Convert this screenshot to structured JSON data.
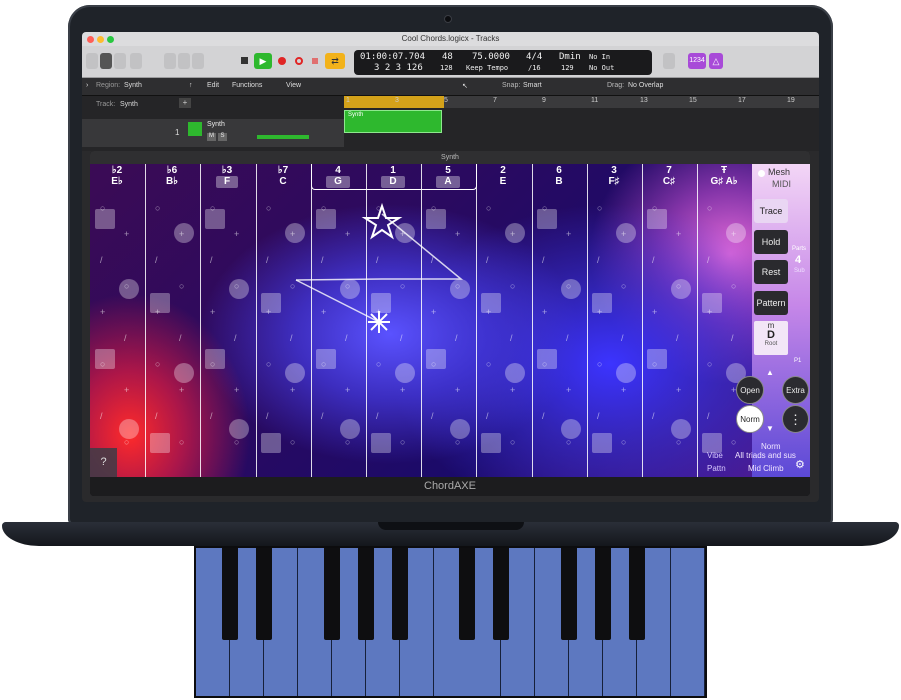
{
  "window": {
    "title": "Cool Chords.logicx - Tracks"
  },
  "lcd": {
    "time": "01:00:07.704",
    "bars": "3  2  3  126",
    "bar_top": "48",
    "bar_bottom": "128",
    "tempo": "75.0000",
    "tempo_mode": "Keep Tempo",
    "sig_top": "4/4",
    "sig_bottom": "/16",
    "key_top": "Dmin",
    "key_bottom": "129",
    "in_top": "No In",
    "in_bottom": "No Out"
  },
  "toolbar": {
    "count_in": "1234"
  },
  "region": {
    "label": "Region:",
    "value": "Synth",
    "track_label": "Track:",
    "track_value": "Synth",
    "menus": [
      "Edit",
      "Functions",
      "View"
    ],
    "snap_label": "Snap:",
    "snap_value": "Smart",
    "drag_label": "Drag:",
    "drag_value": "No Overlap"
  },
  "ruler": [
    "1",
    "3",
    "5",
    "7",
    "9",
    "11",
    "13",
    "15",
    "17",
    "19"
  ],
  "track": {
    "number": "1",
    "name": "Synth",
    "m": "M",
    "s": "S",
    "region_name": "Synth"
  },
  "plugin": {
    "window_title": "Synth",
    "footer": "ChordAXE",
    "columns": [
      {
        "degree": "♭2",
        "note": "E♭"
      },
      {
        "degree": "♭6",
        "note": "B♭"
      },
      {
        "degree": "♭3",
        "note": "F"
      },
      {
        "degree": "♭7",
        "note": "C"
      },
      {
        "degree": "4",
        "note": "G"
      },
      {
        "degree": "1",
        "note": "D"
      },
      {
        "degree": "5",
        "note": "A"
      },
      {
        "degree": "2",
        "note": "E"
      },
      {
        "degree": "6",
        "note": "B"
      },
      {
        "degree": "3",
        "note": "F♯"
      },
      {
        "degree": "7",
        "note": "C♯"
      },
      {
        "degree": "Ŧ",
        "note": "G♯ A♭"
      }
    ],
    "help": "?",
    "side": {
      "mesh": "Mesh",
      "midi": "MIDI",
      "trace": "Trace",
      "hold": "Hold",
      "rest": "Rest",
      "pattern": "Pattern",
      "parts_label": "Parts",
      "parts_value": "4",
      "sub_label": "Sub",
      "mode": "m",
      "root_note": "D",
      "root_label": "Root",
      "p_label": "P1",
      "open": "Open",
      "extra": "Extra",
      "norm_btn": "Norm",
      "norm_label": "Norm",
      "more": "⋮"
    },
    "vibe_label": "Vibe",
    "vibe_value": "All triads and sus",
    "pattn_label": "Pattn",
    "pattn_value": "Mid Climb"
  },
  "colors": {
    "accent_green": "#2eb82e",
    "lcd_bg": "#1a1a1c",
    "key_blue": "#5d78c0"
  }
}
